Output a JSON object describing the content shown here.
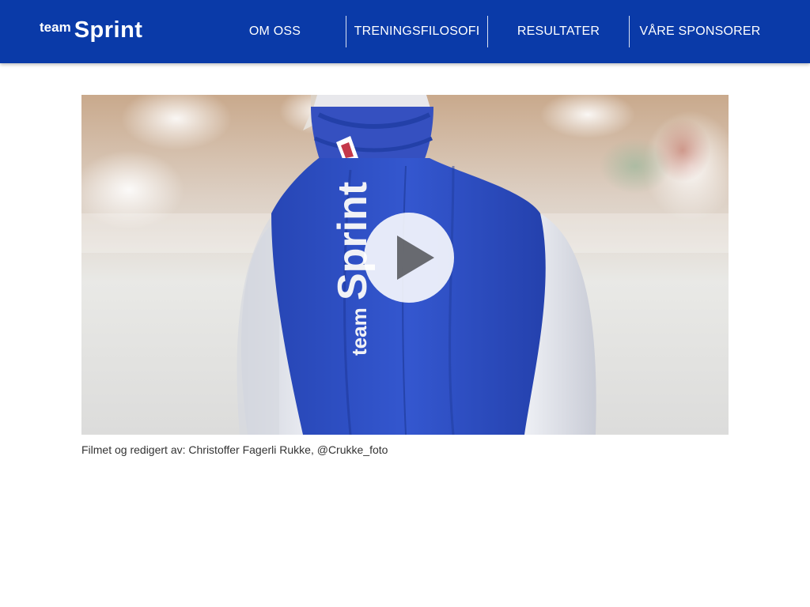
{
  "header": {
    "logo": {
      "team": "team",
      "sprint": "Sprint"
    },
    "nav": [
      {
        "label": "OM OSS"
      },
      {
        "label": "TRENINGSFILOSOFI"
      },
      {
        "label": "RESULTATER"
      },
      {
        "label": "VÅRE SPONSORER"
      }
    ]
  },
  "video": {
    "suit_text_team": "team",
    "suit_text_sprint": "Sprint",
    "play_icon": "play-icon"
  },
  "caption": "Filmet og redigert av: Christoffer Fagerli Rukke, @Crukke_foto",
  "colors": {
    "header_bg": "#0a3aa8",
    "suit_blue": "#2d4fc4",
    "sleeve_white": "#e4e6ee"
  }
}
